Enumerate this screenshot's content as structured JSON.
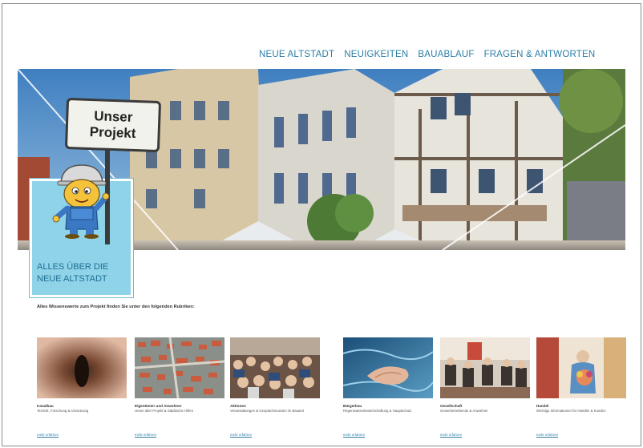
{
  "nav": {
    "items": [
      {
        "label": "NEUE ALTSTADT"
      },
      {
        "label": "NEUIGKEITEN"
      },
      {
        "label": "BAUABLAUF"
      },
      {
        "label": "FRAGEN & ANTWORTEN"
      }
    ]
  },
  "hero": {
    "sign_text": "Unser\nProjekt",
    "box_title": "ALLES ÜBER DIE NEUE ALTSTADT"
  },
  "intro": {
    "text": "Alles Wissenswerte zum Projekt finden Sie unter den folgenden Rubriken:"
  },
  "cards": [
    {
      "title": "Kanalbau",
      "desc": "Technik, Forschung & Umsetzung",
      "link": "mehr erfahren",
      "icon": "pipe-image"
    },
    {
      "title": "Eigentümer und Anwohner",
      "desc": "Unser alter Projekt & Städtische Hilfen",
      "link": "mehr erfahren",
      "icon": "aerial-map-image"
    },
    {
      "title": "Aktionen",
      "desc": "Veranstaltungen & Gesprächsrunden im Bauamt",
      "link": "mehr erfahren",
      "icon": "crowd-image"
    },
    {
      "title": "Bürgerbau",
      "desc": "Regenwasserbewirtschaftung & Hauptschutz",
      "link": "mehr erfahren",
      "icon": "water-hands-image"
    },
    {
      "title": "Gesellschaft",
      "desc": "Gewerbetreibende & Anwohner",
      "link": "mehr erfahren",
      "icon": "meeting-image"
    },
    {
      "title": "Handel",
      "desc": "Wichtige Informationen für Händler & Kunden",
      "link": "mehr erfahren",
      "icon": "market-image"
    }
  ],
  "colors": {
    "accent": "#2a7ea6",
    "info_box": "#8fd3e8",
    "sign_bg": "#f2f2ec"
  }
}
